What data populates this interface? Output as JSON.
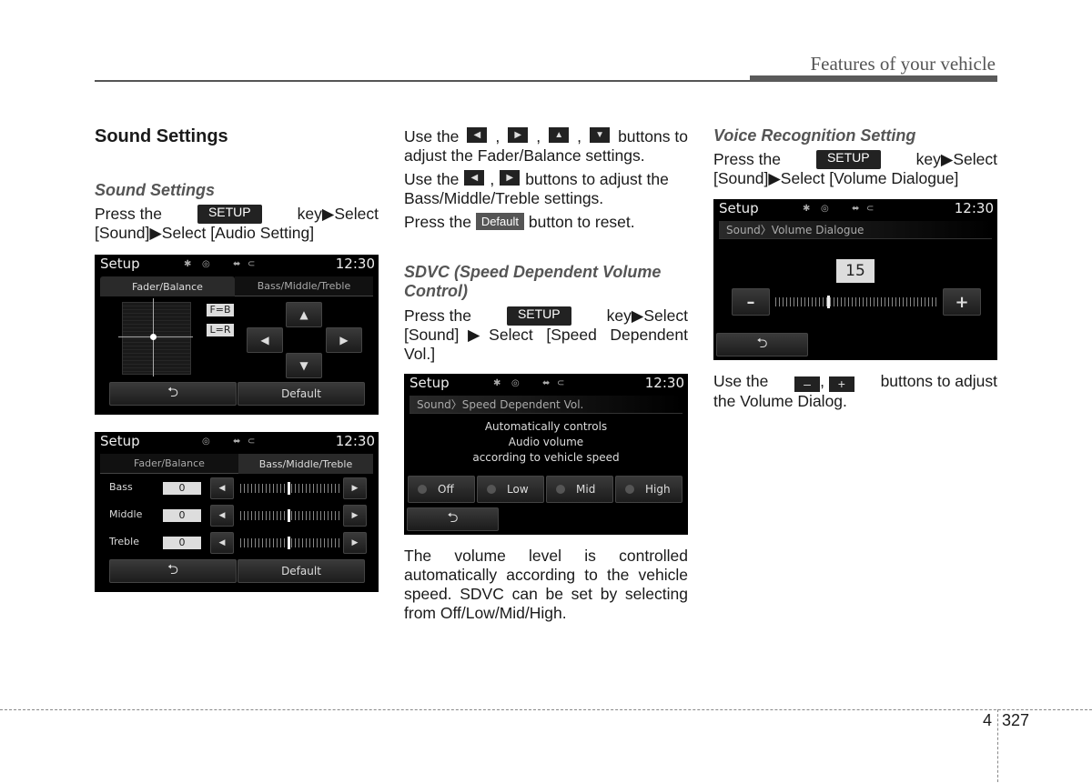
{
  "header": {
    "section_title": "Features of your vehicle"
  },
  "footer": {
    "chapter": "4",
    "page": "327"
  },
  "col1": {
    "heading": "Sound Settings",
    "subheading": "Sound Settings",
    "press": "Press the",
    "key": "SETUP",
    "key_suffix": "key▶Select",
    "path": "[Sound]▶Select [Audio Setting]"
  },
  "col2": {
    "use1_pre": "Use the",
    "use1_post": "buttons to",
    "use1_line2": "adjust the Fader/Balance settings.",
    "use2_pre": "Use the",
    "use2_post": "buttons to adjust the",
    "use2_line2": "Bass/Middle/Treble settings.",
    "press_pre": "Press the",
    "default_key": "Default",
    "press_post": "button to reset.",
    "sdvc_heading": "SDVC (Speed Dependent Volume Control)",
    "press": "Press the",
    "key": "SETUP",
    "key_suffix": "key▶Select",
    "path": "[Sound]▶Select [Speed Dependent Vol.]",
    "body": "The volume level is controlled automatically according to the vehicle speed. SDVC can be set by selecting from Off/Low/Mid/High."
  },
  "col3": {
    "heading": "Voice Recognition Setting",
    "press": "Press the",
    "key": "SETUP",
    "key_suffix": "key▶Select",
    "path": "[Sound]▶Select [Volume Dialogue]",
    "use_pre": "Use the",
    "use_post": "buttons to adjust",
    "use_line2": "the Volume Dialog."
  },
  "screens": {
    "common": {
      "title": "Setup",
      "time": "12:30",
      "back": "⮌",
      "default": "Default"
    },
    "fader": {
      "tab1": "Fader/Balance",
      "tab2": "Bass/Middle/Treble",
      "fb": "F=B",
      "lr": "L=R"
    },
    "bmt": {
      "tab1": "Fader/Balance",
      "tab2": "Bass/Middle/Treble",
      "rows": [
        {
          "label": "Bass",
          "value": "0"
        },
        {
          "label": "Middle",
          "value": "0"
        },
        {
          "label": "Treble",
          "value": "0"
        }
      ]
    },
    "sdvc": {
      "crumb": "Sound〉Speed Dependent Vol.",
      "desc1": "Automatically controls",
      "desc2": "Audio volume",
      "desc3": "according to vehicle speed",
      "options": [
        "Off",
        "Low",
        "Mid",
        "High"
      ]
    },
    "voice": {
      "crumb": "Sound〉Volume Dialogue",
      "value": "15",
      "minus": "–",
      "plus": "+"
    }
  }
}
